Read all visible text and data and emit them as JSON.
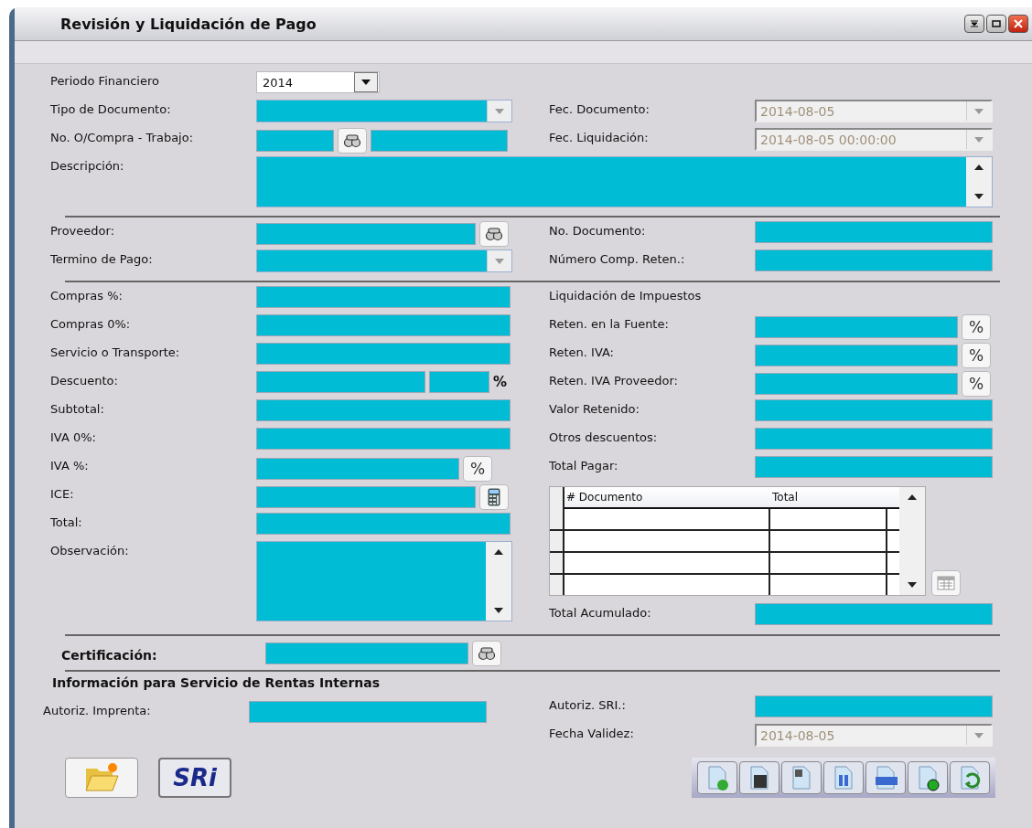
{
  "window": {
    "title": "Revisión y Liquidación de Pago"
  },
  "general": {
    "left": [
      {
        "kind": "select",
        "label": "Periodo Financiero",
        "value": "2014"
      },
      {
        "kind": "combo",
        "label": "Tipo de Documento:"
      },
      {
        "kind": "order",
        "label": "No. O/Compra - Trabajo:"
      }
    ],
    "right": [
      {
        "kind": "date",
        "label": "Fec. Documento:",
        "value": "2014-08-05"
      },
      {
        "kind": "date",
        "label": "Fec. Liquidación:",
        "value": "2014-08-05 00:00:00"
      }
    ],
    "description": {
      "label": "Descripción:"
    }
  },
  "supplier": {
    "left": [
      {
        "kind": "lookup",
        "label": "Proveedor:"
      },
      {
        "kind": "combo",
        "label": "Termino de Pago:"
      }
    ],
    "right": [
      {
        "kind": "text",
        "label": "No. Documento:"
      },
      {
        "kind": "text",
        "label": "Número Comp. Reten.:"
      }
    ]
  },
  "amounts": {
    "left": [
      {
        "kind": "text",
        "label": "Compras %:"
      },
      {
        "kind": "text",
        "label": "Compras 0%:"
      },
      {
        "kind": "text",
        "label": "Servicio o Transporte:"
      },
      {
        "kind": "discount",
        "label": "Descuento:",
        "suffix": "%"
      },
      {
        "kind": "text",
        "label": "Subtotal:"
      },
      {
        "kind": "text",
        "label": "IVA 0%:"
      },
      {
        "kind": "percent",
        "label": "IVA %:",
        "button": "%"
      },
      {
        "kind": "calc",
        "label": "ICE:"
      },
      {
        "kind": "text",
        "label": "Total:"
      },
      {
        "kind": "memo",
        "label": "Observación:"
      }
    ],
    "right": [
      {
        "kind": "heading",
        "label": "Liquidación de Impuestos"
      },
      {
        "kind": "percent",
        "label": "Reten. en la Fuente:",
        "button": "%"
      },
      {
        "kind": "percent",
        "label": "Reten. IVA:",
        "button": "%"
      },
      {
        "kind": "percent",
        "label": "Reten. IVA Proveedor:",
        "button": "%"
      },
      {
        "kind": "text",
        "label": "Valor Retenido:"
      },
      {
        "kind": "text",
        "label": "Otros descuentos:"
      },
      {
        "kind": "text",
        "label": "Total Pagar:"
      },
      {
        "kind": "grid",
        "columns": [
          "# Documento",
          "Total"
        ]
      },
      {
        "kind": "text",
        "label": "Total Acumulado:"
      }
    ]
  },
  "certification": {
    "label": "Certificación:"
  },
  "sri_info": {
    "title": "Información para Servicio de Rentas Internas",
    "left": [
      {
        "kind": "text",
        "label": "Autoriz. Imprenta:"
      }
    ],
    "right": [
      {
        "kind": "text",
        "label": "Autoriz. SRI.:"
      },
      {
        "kind": "date",
        "label": "Fecha Validez:",
        "value": "2014-08-05"
      }
    ]
  },
  "sri_button": {
    "logo": "SRi"
  }
}
